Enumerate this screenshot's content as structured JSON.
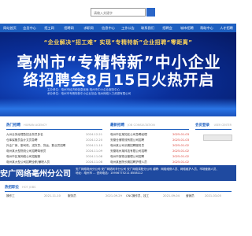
{
  "search": {
    "placeholder": "请输入关键字"
  },
  "nav": {
    "items": [
      "网站首页",
      "会员中心",
      "招工网",
      "招聘网",
      "求职网",
      "信息中心",
      "工作公告",
      "联系我们",
      "招聘会",
      "城市招聘",
      "帮助中心",
      "人才招聘"
    ]
  },
  "banner": {
    "tagline": "“企业解决“招工难”  实现“专精特新”企业招聘“零距离”",
    "headline1": "亳州市“专精特新”中小企业",
    "headline2": "络招聘会8月15日火热开启",
    "org_lines": [
      "主办单位：亳州市经济和信息化局  亳州市中小企业服务中心",
      "承办单位：亳州市专精特新中小企业协会  亳州网络人力资源有限公司"
    ]
  },
  "panels": {
    "jobs": {
      "title": "热门招聘",
      "subtitle": "HUMAN AGENCY",
      "rows": [
        {
          "title": "九州业务经理急招业务员多名",
          "date": "2024-12-21"
        },
        {
          "title": "仓库保管员会计文员急聘",
          "date": "2024-12-20"
        },
        {
          "title": "外企厂房、厨司机、送货员、货运、数业员招聘",
          "date": "2024-11-10"
        },
        {
          "title": "亳州某大型物流公司招聘驾驶员",
          "date": "2024-11-09"
        },
        {
          "title": "亳州市区某网络公司招客服",
          "date": "2024-11-08"
        },
        {
          "title": "亳州某大型公司招聘全职/兼职人员",
          "date": "2024-11-08"
        }
      ]
    },
    "news": {
      "title": "最新招聘",
      "subtitle": "JOB CONSULTATION",
      "rows": [
        {
          "title": "亳州市区某知名公司急聘经理",
          "date": "2025-01-03"
        },
        {
          "title": "安徽仓储物流有限公司招聘",
          "date": "2025-01-03"
        },
        {
          "title": "亳州某公司长期招聘服务员",
          "date": "2025-01-02"
        },
        {
          "title": "安徽亳州某科技有限公司招聘",
          "date": "2025-01-02"
        },
        {
          "title": "亳州市某物业管理公司招聘",
          "date": "2025-01-02"
        },
        {
          "title": "亳州某医院长期招聘护理人员",
          "date": "2025-01-02"
        }
      ]
    },
    "user": {
      "title": "会员登录",
      "subtitle": "USER CENTER"
    }
  },
  "contact": {
    "logo": "安广网络亳州分公司",
    "lines": [
      "安广网络亳州分公司  安广网络利辛分公司  安广网络涡阳分公司  诚聘：网络维修人员、网络维护人员、市场营销人员、",
      "地址：亳州市  ...   咨询电话：15956775211 8558112"
    ]
  },
  "bottom": {
    "title": "热招职位",
    "subtitle": "HOT JOBS",
    "items": [
      {
        "title": "操作工",
        "date": "2021-11-10"
      },
      {
        "title": "服务员",
        "date": "2021-09-29"
      },
      {
        "title": "CNC操作员、技工",
        "date": "2021-09-04"
      },
      {
        "title": "营销员",
        "date": "2021-03-05"
      }
    ]
  }
}
